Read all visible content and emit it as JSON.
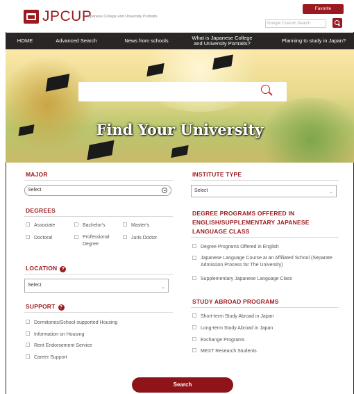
{
  "header": {
    "logo_text": "JPCUP",
    "tagline": "Japanese College and University Portraits",
    "favorite_label": "Favorite",
    "search_placeholder": "Google Custom Search"
  },
  "nav": [
    {
      "label": "HOME"
    },
    {
      "label": "Advanced Search"
    },
    {
      "label": "News from schools"
    },
    {
      "label": "What is Japanese College and University Portraits?"
    },
    {
      "label": "Planning to study in Japan?"
    }
  ],
  "hero": {
    "title": "Find Your University"
  },
  "major": {
    "title": "MAJOR",
    "select_value": "Select"
  },
  "degrees": {
    "title": "DEGREES",
    "options": [
      "Associate",
      "Bachelor's",
      "Master's",
      "Doctoral",
      "Professional Degree",
      "Juris Doctor"
    ]
  },
  "location": {
    "title": "LOCATION",
    "help_icon": "?",
    "select_value": "Select"
  },
  "support": {
    "title": "SUPPORT",
    "help_icon": "?",
    "options": [
      "Dormitories/School-supported Housing",
      "Information on Housing",
      "Rent Endorsement Service",
      "Career Support"
    ]
  },
  "institute_type": {
    "title": "INSTITUTE TYPE",
    "select_value": "Select"
  },
  "degree_programs": {
    "title": "DEGREE PROGRAMS OFFERED IN ENGLISH/SUPPLEMENTARY JAPANESE LANGUAGE CLASS",
    "options": [
      "Degree Programs Offered in English",
      "Japanese Language Course at an Affiliated School (Separate Admission Process for The University)",
      "Supplementary Japanese Language Class"
    ]
  },
  "study_abroad": {
    "title": "STUDY ABROAD PROGRAMS",
    "options": [
      "Short-term Study Abroad in Japan",
      "Long-term Study Abroad in Japan",
      "Exchange Programs",
      "MEXT Research Students"
    ]
  },
  "search_button_label": "Search",
  "colors": {
    "brand": "#9a1a1f",
    "nav_bg": "#2b2626"
  }
}
